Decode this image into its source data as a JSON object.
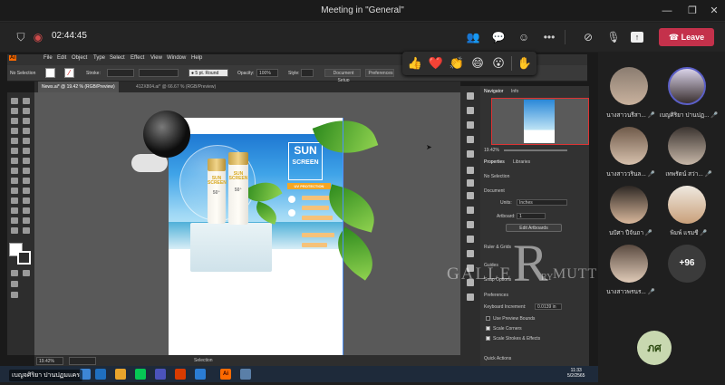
{
  "window": {
    "title": "Meeting in \"General\"",
    "minimize": "—",
    "maximize": "❐",
    "close": "✕"
  },
  "meeting": {
    "timer": "02:44:45",
    "leave_label": "Leave",
    "reactions": [
      "👍",
      "❤️",
      "👏",
      "😄",
      "😮"
    ],
    "raise_hand": "✋"
  },
  "illustrator": {
    "menu": [
      "Ai",
      "File",
      "Edit",
      "Object",
      "Type",
      "Select",
      "Effect",
      "View",
      "Window",
      "Help"
    ],
    "control": {
      "selection": "No Selection",
      "stroke_label": "Stroke:",
      "brush": "5 pt. Round",
      "opacity_label": "Opacity:",
      "opacity": "100%",
      "style_label": "Style:",
      "doc_setup": "Document Setup",
      "preferences": "Preferences"
    },
    "tabs": [
      "News.ai* @ 19.42 % (RGB/Preview)",
      "412X804.ai* @ 66.67 % (RGB/Preview)"
    ],
    "status": {
      "zoom": "19.42%",
      "tool": "Selection"
    },
    "artwork": {
      "title_line1": "SUN",
      "title_line2": "SCREEN",
      "tag": "UV PROTECTION",
      "bottle1_text": "SUN SCREEN",
      "bottle2_text": "SUN SCREEN",
      "spf": "50⁺"
    },
    "panels": {
      "navigator_tab": "Navigator",
      "info_tab": "Info",
      "nav_zoom": "19.42%",
      "properties_tab": "Properties",
      "libraries_tab": "Libraries",
      "no_selection": "No Selection",
      "document_label": "Document",
      "units_label": "Units:",
      "units_value": "Inches",
      "artboard_label": "Artboard:",
      "artboard_value": "1",
      "edit_artboards": "Edit Artboards",
      "rulers_grids": "Ruler & Grids",
      "guides": "Guides",
      "snap_options": "Snap Options",
      "preferences_label": "Preferences",
      "keyboard_increment_label": "Keyboard Increment:",
      "keyboard_increment_value": "0.0139 in",
      "use_preview_bounds": "Use Preview Bounds",
      "scale_corners": "Scale Corners",
      "scale_strokes": "Scale Strokes & Effects",
      "quick_actions": "Quick Actions"
    }
  },
  "taskbar": {
    "time": "11:33",
    "date": "5/2/2565"
  },
  "caption": "เบญจศิริยา ปานปฏมแคร",
  "watermark": {
    "left": "GALLE",
    "big": "R",
    "right": "MUTT",
    "ry": "RY"
  },
  "participants": [
    {
      "name": "นางสาวนรีสา...",
      "mic": "🎤"
    },
    {
      "name": "เบญศิริยา ปานปฏ...",
      "mic": "🎤"
    },
    {
      "name": "นางสาววรินล...",
      "mic": "🎤"
    },
    {
      "name": "เทพรัตน์ สว่า...",
      "mic": "🎤"
    },
    {
      "name": "นปัศา ปีจันถา",
      "mic": "🎤"
    },
    {
      "name": "พิมพ์ แรมชี",
      "mic": "🎤"
    },
    {
      "name": "นางสาวพรนร...",
      "mic": "🎤"
    }
  ],
  "more_participants": "+96",
  "self_initials": "ภศ"
}
